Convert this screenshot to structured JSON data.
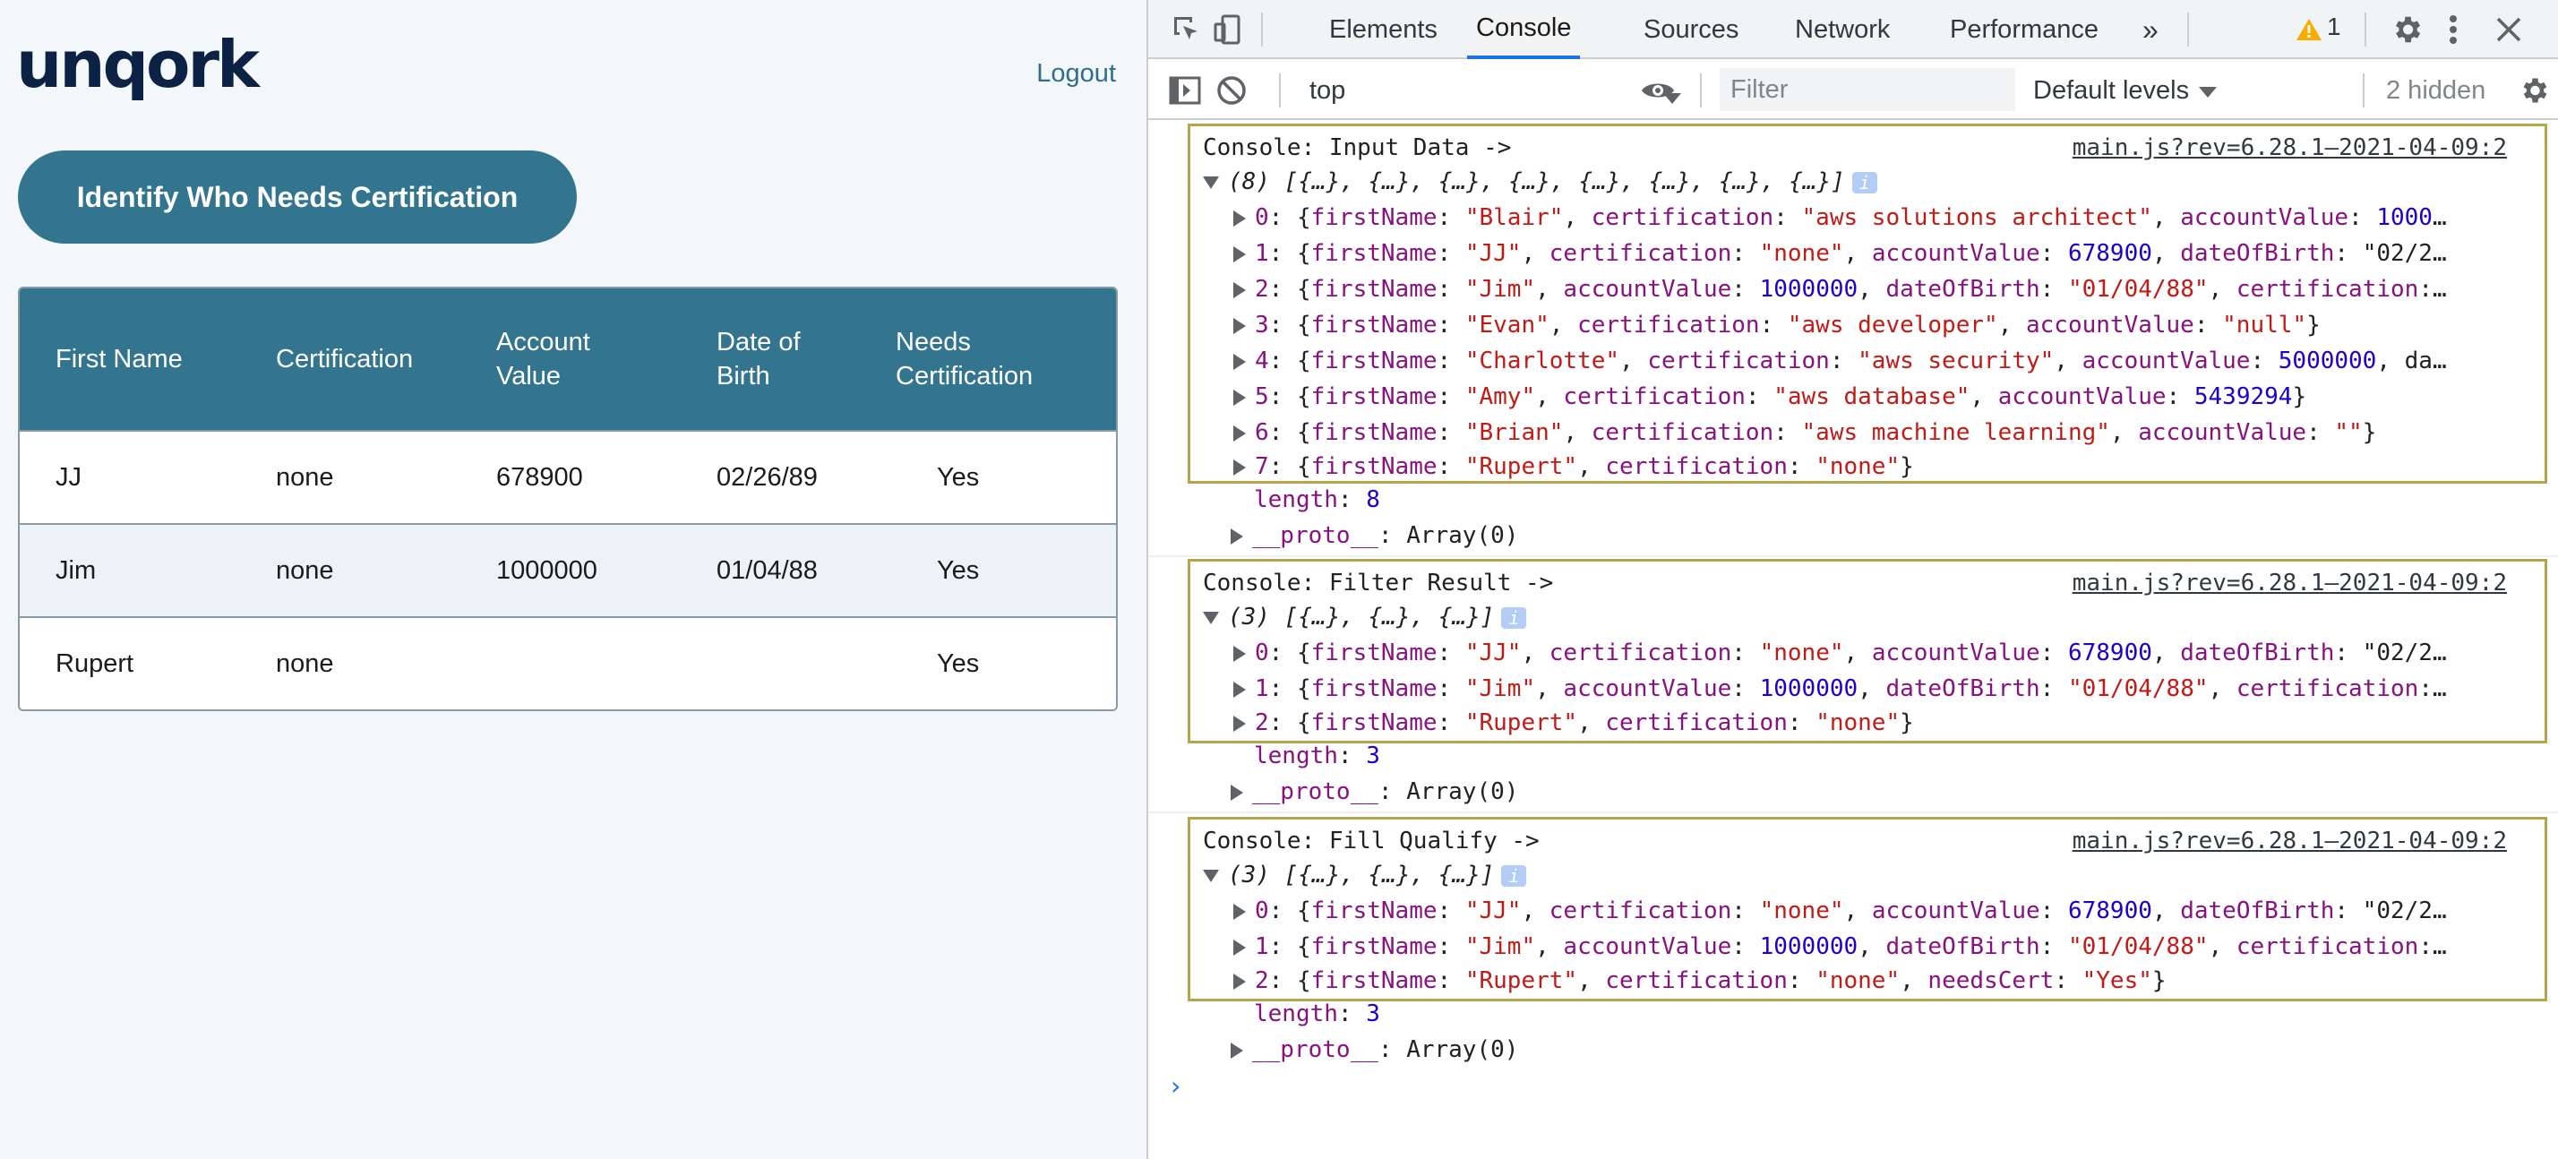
{
  "app": {
    "logo": "unqork",
    "logout": "Logout",
    "button": "Identify Who Needs Certification",
    "table": {
      "headers": [
        "First Name",
        "Certification",
        "Account Value",
        "Date of Birth",
        "Needs Certification"
      ],
      "rows": [
        [
          "JJ",
          "none",
          "678900",
          "02/26/89",
          "Yes"
        ],
        [
          "Jim",
          "none",
          "1000000",
          "01/04/88",
          "Yes"
        ],
        [
          "Rupert",
          "none",
          "",
          "",
          "Yes"
        ]
      ]
    }
  },
  "devtools": {
    "tabs": [
      "Elements",
      "Console",
      "Sources",
      "Network",
      "Performance"
    ],
    "active_tab": "Console",
    "more_tabs": "»",
    "warning_count": "1",
    "context": "top",
    "filter_placeholder": "Filter",
    "levels": "Default levels",
    "hidden": "2 hidden",
    "source_link": "main.js?rev=6.28.1–2021-04-09:2",
    "groups": [
      {
        "title": "Console: Input Data ->",
        "summary": "(8) [{…}, {…}, {…}, {…}, {…}, {…}, {…}, {…}]",
        "items": [
          "0: {firstName: \"Blair\", certification: \"aws solutions architect\", accountValue: 1000…",
          "1: {firstName: \"JJ\", certification: \"none\", accountValue: 678900, dateOfBirth: \"02/2…",
          "2: {firstName: \"Jim\", accountValue: 1000000, dateOfBirth: \"01/04/88\", certification:…",
          "3: {firstName: \"Evan\", certification: \"aws developer\", accountValue: \"null\"}",
          "4: {firstName: \"Charlotte\", certification: \"aws security\", accountValue: 5000000, da…",
          "5: {firstName: \"Amy\", certification: \"aws database\", accountValue: 5439294}",
          "6: {firstName: \"Brian\", certification: \"aws machine learning\", accountValue: \"\"}",
          "7: {firstName: \"Rupert\", certification: \"none\"}"
        ],
        "length": "8",
        "proto": "__proto__: Array(0)"
      },
      {
        "title": "Console: Filter Result ->",
        "summary": "(3) [{…}, {…}, {…}]",
        "items": [
          "0: {firstName: \"JJ\", certification: \"none\", accountValue: 678900, dateOfBirth: \"02/2…",
          "1: {firstName: \"Jim\", accountValue: 1000000, dateOfBirth: \"01/04/88\", certification:…",
          "2: {firstName: \"Rupert\", certification: \"none\"}"
        ],
        "length": "3",
        "proto": "__proto__: Array(0)"
      },
      {
        "title": "Console: Fill Qualify ->",
        "summary": "(3) [{…}, {…}, {…}]",
        "items": [
          "0: {firstName: \"JJ\", certification: \"none\", accountValue: 678900, dateOfBirth: \"02/2…",
          "1: {firstName: \"Jim\", accountValue: 1000000, dateOfBirth: \"01/04/88\", certification:…",
          "2: {firstName: \"Rupert\", certification: \"none\", needsCert: \"Yes\"}"
        ],
        "length": "3",
        "proto": "__proto__: Array(0)"
      }
    ],
    "prompt": "›"
  },
  "colors": {
    "brand": "#33758f",
    "logo": "#0b2244",
    "group_border": "#b5a64c",
    "string": "#c41a16",
    "number": "#1c00cf",
    "key": "#881280",
    "active_tab": "#1a73e8"
  }
}
